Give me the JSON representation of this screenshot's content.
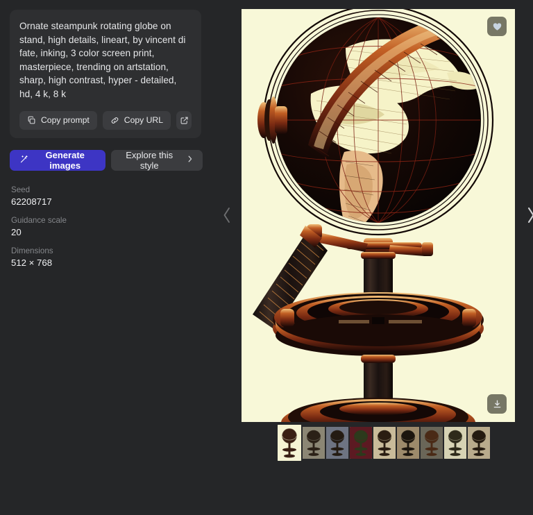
{
  "prompt_card": {
    "prompt": "Ornate steampunk rotating globe on stand, high details, lineart, by vincent di fate, inking, 3 color screen print, masterpiece, trending on artstation, sharp, high contrast, hyper - detailed, hd, 4 k, 8 k",
    "copy_prompt_label": "Copy prompt",
    "copy_url_label": "Copy URL",
    "open_external_label": ""
  },
  "actions": {
    "generate_label": "Generate images",
    "explore_label": "Explore this style",
    "explore_chevron": "›",
    "primary_color": "#3d35c4"
  },
  "meta": {
    "seed_label": "Seed",
    "seed_value": "62208717",
    "guidance_label": "Guidance scale",
    "guidance_value": "20",
    "dimensions_label": "Dimensions",
    "dimensions_value": "512 × 768"
  },
  "viewer": {
    "image_alt": "Ornate steampunk rotating globe on stand",
    "background_color": "#f8f8d8",
    "prev_icon": "chevron-left",
    "next_icon": "chevron-right",
    "favorite_icon": "heart",
    "download_icon": "download",
    "thumbnails": [
      {
        "index": 1,
        "selected": true,
        "bg": "#f6f4d4",
        "tint": "#3a1f14"
      },
      {
        "index": 2,
        "selected": false,
        "bg": "#8b8674",
        "tint": "#2b2117"
      },
      {
        "index": 3,
        "selected": false,
        "bg": "#6e7482",
        "tint": "#241b12"
      },
      {
        "index": 4,
        "selected": false,
        "bg": "#5c1a22",
        "tint": "#2c3a1c"
      },
      {
        "index": 5,
        "selected": false,
        "bg": "#c9bb9a",
        "tint": "#2a1d12"
      },
      {
        "index": 6,
        "selected": false,
        "bg": "#9d8a6b",
        "tint": "#1c150e"
      },
      {
        "index": 7,
        "selected": false,
        "bg": "#6a6658",
        "tint": "#4a2a16"
      },
      {
        "index": 8,
        "selected": false,
        "bg": "#d7d3b4",
        "tint": "#2e2a1a"
      },
      {
        "index": 9,
        "selected": false,
        "bg": "#b9ab8c",
        "tint": "#241a10"
      }
    ]
  }
}
